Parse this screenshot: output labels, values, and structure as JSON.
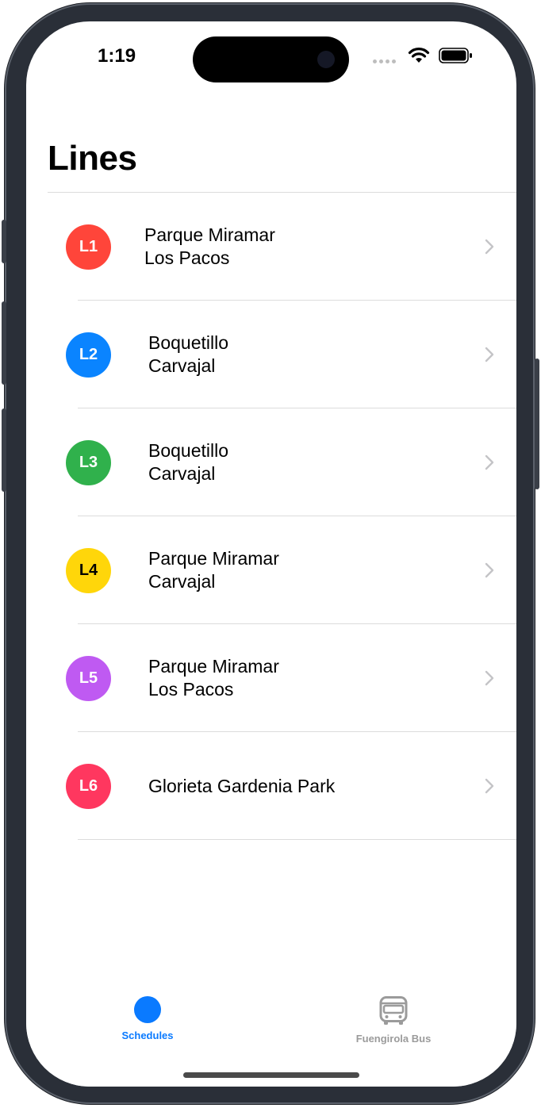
{
  "status_bar": {
    "time": "1:19"
  },
  "page": {
    "title": "Lines"
  },
  "lines": [
    {
      "badge": "L1",
      "stops": [
        "Parque Miramar",
        "Los Pacos"
      ],
      "color": "#ff453a",
      "badge_text_color": "#ffffff"
    },
    {
      "badge": "L2",
      "stops": [
        "Boquetillo",
        "Carvajal"
      ],
      "color": "#0a84ff",
      "badge_text_color": "#ffffff"
    },
    {
      "badge": "L3",
      "stops": [
        "Boquetillo",
        "Carvajal"
      ],
      "color": "#30b14c",
      "badge_text_color": "#ffffff"
    },
    {
      "badge": "L4",
      "stops": [
        "Parque Miramar",
        "Carvajal"
      ],
      "color": "#ffd60a",
      "badge_text_color": "#000000"
    },
    {
      "badge": "L5",
      "stops": [
        "Parque Miramar",
        "Los Pacos"
      ],
      "color": "#bf5af2",
      "badge_text_color": "#ffffff"
    },
    {
      "badge": "L6",
      "stops": [
        "Glorieta Gardenia Park"
      ],
      "color": "#ff375f",
      "badge_text_color": "#ffffff"
    }
  ],
  "tab_bar": {
    "tabs": [
      {
        "label": "Schedules",
        "icon": "circle-icon",
        "active": true
      },
      {
        "label": "Fuengirola Bus",
        "icon": "bus-icon",
        "active": false
      }
    ]
  },
  "colors": {
    "accent": "#0a7aff",
    "inactive": "#9b9b9b",
    "divider": "#dcdcdc",
    "chevron": "#c4c4c7"
  }
}
